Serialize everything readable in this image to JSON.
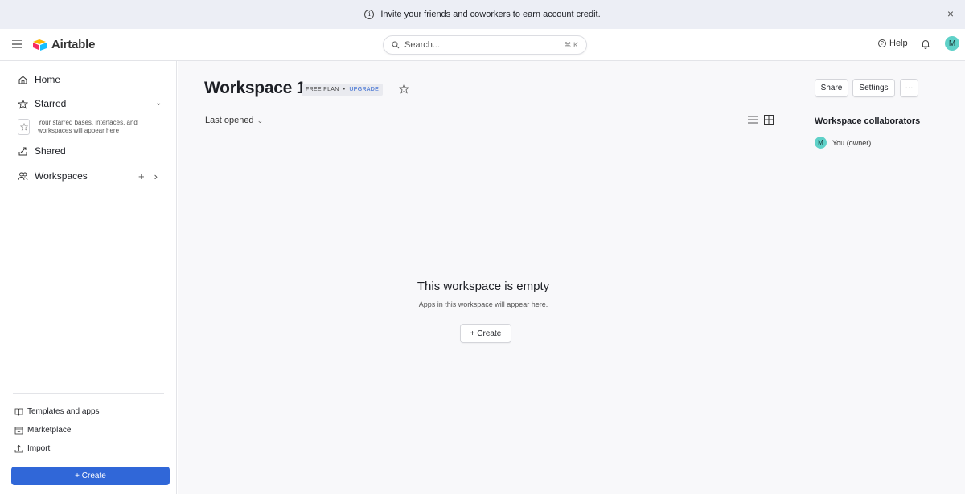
{
  "banner": {
    "link_text": "Invite your friends and coworkers",
    "rest_text": "to earn account credit.",
    "info_icon": "info-icon",
    "close_glyph": "×"
  },
  "header": {
    "logo_text": "Airtable",
    "search_placeholder": "Search...",
    "search_shortcut": "⌘ K",
    "help_label": "Help",
    "avatar_initial": "M"
  },
  "sidebar": {
    "home_label": "Home",
    "starred_label": "Starred",
    "starred_empty_text": "Your starred bases, interfaces, and workspaces will appear here",
    "shared_label": "Shared",
    "workspaces_label": "Workspaces",
    "workspaces_add": "+",
    "workspaces_expand": "›",
    "templates_label": "Templates and apps",
    "marketplace_label": "Marketplace",
    "import_label": "Import",
    "create_label": "+  Create"
  },
  "main": {
    "workspace_title": "Workspace 1",
    "plan_label": "FREE PLAN",
    "plan_separator": "•",
    "upgrade_label": "UPGRADE",
    "sort_label": "Last opened",
    "share_label": "Share",
    "settings_label": "Settings",
    "more_label": "···",
    "collaborators_title": "Workspace collaborators",
    "collaborator_initial": "M",
    "collaborator_name": "You (owner)",
    "empty_title": "This workspace is empty",
    "empty_subtitle": "Apps in this workspace will appear here.",
    "empty_create_label": "+  Create"
  },
  "colors": {
    "banner_bg": "#eceef5",
    "primary_blue": "#3067d8",
    "avatar_teal": "#5fd1c8",
    "main_bg": "#f8f8fa"
  }
}
